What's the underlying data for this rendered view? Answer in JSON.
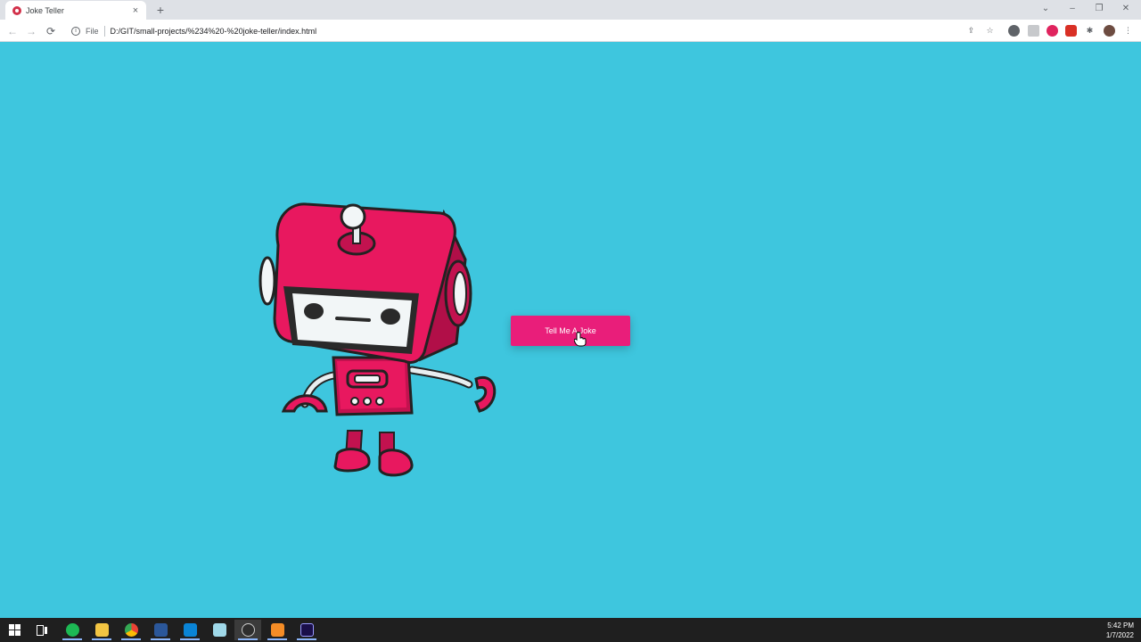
{
  "browser": {
    "tab_title": "Joke Teller",
    "tab_close": "×",
    "new_tab": "+",
    "address_scheme": "File",
    "address_url": "D:/GIT/small-projects/%234%20-%20joke-teller/index.html",
    "window_controls": {
      "minimize": "–",
      "restore": "❐",
      "close": "✕",
      "tab_search": "⌄"
    },
    "nav": {
      "back": "←",
      "forward": "→",
      "reload": "⟳"
    }
  },
  "page": {
    "button_label": "Tell Me A Joke",
    "background_color": "#3ec6de",
    "accent_color": "#e91e7a"
  },
  "taskbar": {
    "apps": [
      "start-icon",
      "task-view-icon",
      "spotify-icon",
      "file-explorer-icon",
      "chrome-icon",
      "word-icon",
      "vscode-icon",
      "notepad-icon",
      "obs-icon",
      "sublime-icon",
      "premiere-icon"
    ],
    "time": "5:42 PM",
    "date": "1/7/2022"
  }
}
